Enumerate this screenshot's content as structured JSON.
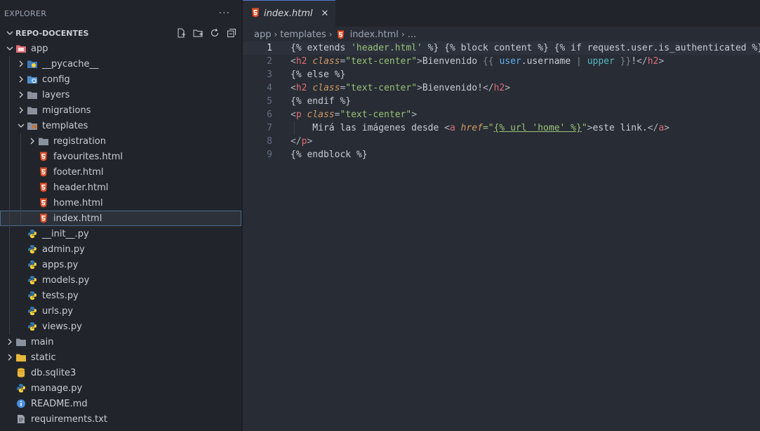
{
  "sidebar": {
    "header": "EXPLORER",
    "more": "···",
    "project": "REPO-DOCENTES",
    "tree": [
      {
        "label": "app",
        "depth": 0,
        "kind": "folder-open",
        "icon": "app-folder-icon"
      },
      {
        "label": "__pycache__",
        "depth": 1,
        "kind": "folder",
        "icon": "pycache-folder-icon"
      },
      {
        "label": "config",
        "depth": 1,
        "kind": "folder",
        "icon": "config-folder-icon"
      },
      {
        "label": "layers",
        "depth": 1,
        "kind": "folder",
        "icon": "folder-icon"
      },
      {
        "label": "migrations",
        "depth": 1,
        "kind": "folder",
        "icon": "folder-icon"
      },
      {
        "label": "templates",
        "depth": 1,
        "kind": "folder-open",
        "icon": "templates-folder-icon"
      },
      {
        "label": "registration",
        "depth": 2,
        "kind": "folder",
        "icon": "folder-icon"
      },
      {
        "label": "favourites.html",
        "depth": 2,
        "kind": "file",
        "icon": "html-icon"
      },
      {
        "label": "footer.html",
        "depth": 2,
        "kind": "file",
        "icon": "html-icon"
      },
      {
        "label": "header.html",
        "depth": 2,
        "kind": "file",
        "icon": "html-icon"
      },
      {
        "label": "home.html",
        "depth": 2,
        "kind": "file",
        "icon": "html-icon"
      },
      {
        "label": "index.html",
        "depth": 2,
        "kind": "file",
        "icon": "html-icon",
        "selected": true
      },
      {
        "label": "__init__.py",
        "depth": 1,
        "kind": "file",
        "icon": "python-icon"
      },
      {
        "label": "admin.py",
        "depth": 1,
        "kind": "file",
        "icon": "python-icon"
      },
      {
        "label": "apps.py",
        "depth": 1,
        "kind": "file",
        "icon": "python-icon"
      },
      {
        "label": "models.py",
        "depth": 1,
        "kind": "file",
        "icon": "python-icon"
      },
      {
        "label": "tests.py",
        "depth": 1,
        "kind": "file",
        "icon": "python-icon"
      },
      {
        "label": "urls.py",
        "depth": 1,
        "kind": "file",
        "icon": "python-icon"
      },
      {
        "label": "views.py",
        "depth": 1,
        "kind": "file",
        "icon": "python-icon"
      },
      {
        "label": "main",
        "depth": 0,
        "kind": "folder",
        "icon": "folder-icon"
      },
      {
        "label": "static",
        "depth": 0,
        "kind": "folder",
        "icon": "static-folder-icon"
      },
      {
        "label": "db.sqlite3",
        "depth": 0,
        "kind": "file",
        "icon": "database-icon"
      },
      {
        "label": "manage.py",
        "depth": 0,
        "kind": "file",
        "icon": "python-icon"
      },
      {
        "label": "README.md",
        "depth": 0,
        "kind": "file",
        "icon": "info-icon"
      },
      {
        "label": "requirements.txt",
        "depth": 0,
        "kind": "file",
        "icon": "text-file-icon"
      }
    ]
  },
  "editor": {
    "tab_label": "index.html",
    "close_glyph": "✕",
    "breadcrumb": [
      "app",
      "templates",
      "index.html",
      "..."
    ],
    "breadcrumb_sep": "›",
    "active_line": 1,
    "lines": [
      [
        [
          "{% extends ",
          "dj"
        ],
        [
          "'header.html'",
          "str"
        ],
        [
          " %} {% block content %} {% if request.user.is_authenticated %}",
          "dj"
        ]
      ],
      [
        [
          "<",
          "punc"
        ],
        [
          "h2",
          "tag"
        ],
        [
          " ",
          "punc"
        ],
        [
          "class",
          "attr"
        ],
        [
          "=",
          "punc"
        ],
        [
          "\"text-center\"",
          "str"
        ],
        [
          ">",
          "punc"
        ],
        [
          "Bienvenido ",
          "dj"
        ],
        [
          "{{ ",
          "brace"
        ],
        [
          "user",
          "var"
        ],
        [
          ".",
          "dj"
        ],
        [
          "username",
          "dj"
        ],
        [
          " | ",
          "brace"
        ],
        [
          "upper",
          "filter"
        ],
        [
          " }}",
          "brace"
        ],
        [
          "!",
          "dj"
        ],
        [
          "</",
          "punc"
        ],
        [
          "h2",
          "tag"
        ],
        [
          ">",
          "punc"
        ]
      ],
      [
        [
          "{% else %}",
          "dj"
        ]
      ],
      [
        [
          "<",
          "punc"
        ],
        [
          "h2",
          "tag"
        ],
        [
          " ",
          "punc"
        ],
        [
          "class",
          "attr"
        ],
        [
          "=",
          "punc"
        ],
        [
          "\"text-center\"",
          "str"
        ],
        [
          ">",
          "punc"
        ],
        [
          "Bienvenido!",
          "dj"
        ],
        [
          "</",
          "punc"
        ],
        [
          "h2",
          "tag"
        ],
        [
          ">",
          "punc"
        ]
      ],
      [
        [
          "{% endif %}",
          "dj"
        ]
      ],
      [
        [
          "<",
          "punc"
        ],
        [
          "p",
          "tag"
        ],
        [
          " ",
          "punc"
        ],
        [
          "class",
          "attr"
        ],
        [
          "=",
          "punc"
        ],
        [
          "\"text-center\"",
          "str"
        ],
        [
          ">",
          "punc"
        ]
      ],
      [
        [
          "    Mirá las imágenes desde ",
          "dj"
        ],
        [
          "<",
          "punc"
        ],
        [
          "a",
          "tag"
        ],
        [
          " ",
          "punc"
        ],
        [
          "href",
          "attr"
        ],
        [
          "=\"",
          "str"
        ],
        [
          "{% url 'home' %}",
          "str-ul"
        ],
        [
          "\"",
          "str"
        ],
        [
          ">",
          "punc"
        ],
        [
          "este link.",
          "dj"
        ],
        [
          "</",
          "punc"
        ],
        [
          "a",
          "tag"
        ],
        [
          ">",
          "punc"
        ]
      ],
      [
        [
          "</",
          "punc"
        ],
        [
          "p",
          "tag"
        ],
        [
          ">",
          "punc"
        ]
      ],
      [
        [
          "{% endblock %}",
          "dj"
        ]
      ]
    ]
  },
  "colors": {
    "accent": "#4d78cc",
    "html_icon": "#e44d26",
    "python_blue": "#3776ab",
    "python_yellow": "#ffd43b"
  }
}
